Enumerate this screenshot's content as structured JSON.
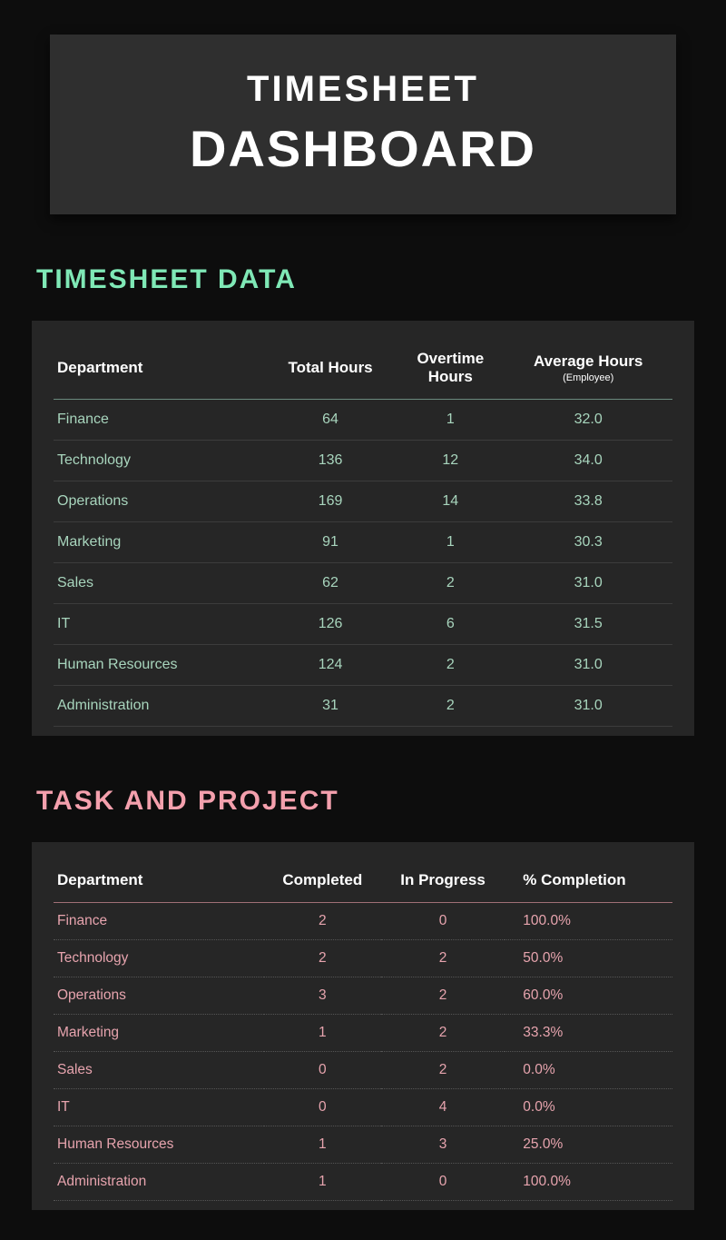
{
  "header": {
    "line1": "TIMESHEET",
    "line2": "DASHBOARD"
  },
  "timesheet_section": {
    "title": "TIMESHEET DATA",
    "columns": {
      "c0": "Department",
      "c1": "Total Hours",
      "c2_a": "Overtime",
      "c2_b": "Hours",
      "c3_a": "Average Hours",
      "c3_b": "(Employee)"
    },
    "rows": [
      {
        "dept": "Finance",
        "total": "64",
        "ot": "1",
        "avg": "32.0"
      },
      {
        "dept": "Technology",
        "total": "136",
        "ot": "12",
        "avg": "34.0"
      },
      {
        "dept": "Operations",
        "total": "169",
        "ot": "14",
        "avg": "33.8"
      },
      {
        "dept": "Marketing",
        "total": "91",
        "ot": "1",
        "avg": "30.3"
      },
      {
        "dept": "Sales",
        "total": "62",
        "ot": "2",
        "avg": "31.0"
      },
      {
        "dept": "IT",
        "total": "126",
        "ot": "6",
        "avg": "31.5"
      },
      {
        "dept": "Human Resources",
        "total": "124",
        "ot": "2",
        "avg": "31.0"
      },
      {
        "dept": "Administration",
        "total": "31",
        "ot": "2",
        "avg": "31.0"
      }
    ]
  },
  "task_section": {
    "title": "TASK AND PROJECT",
    "columns": {
      "c0": "Department",
      "c1": "Completed",
      "c2": "In Progress",
      "c3": "% Completion"
    },
    "rows": [
      {
        "dept": "Finance",
        "completed": "2",
        "inprog": "0",
        "pct": "100.0%"
      },
      {
        "dept": "Technology",
        "completed": "2",
        "inprog": "2",
        "pct": "50.0%"
      },
      {
        "dept": "Operations",
        "completed": "3",
        "inprog": "2",
        "pct": "60.0%"
      },
      {
        "dept": "Marketing",
        "completed": "1",
        "inprog": "2",
        "pct": "33.3%"
      },
      {
        "dept": "Sales",
        "completed": "0",
        "inprog": "2",
        "pct": "0.0%"
      },
      {
        "dept": "IT",
        "completed": "0",
        "inprog": "4",
        "pct": "0.0%"
      },
      {
        "dept": "Human Resources",
        "completed": "1",
        "inprog": "3",
        "pct": "25.0%"
      },
      {
        "dept": "Administration",
        "completed": "1",
        "inprog": "0",
        "pct": "100.0%"
      }
    ]
  }
}
